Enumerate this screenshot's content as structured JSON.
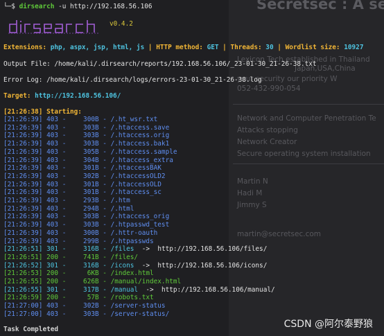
{
  "background_page": {
    "title": "Secretsec : A sec",
    "lines": [
      "Lexicon Tech established in Thailand",
      "Japan,USA,China",
      "your security our priority   W",
      "052-432-990-054",
      "Network and Computer Penetration Te",
      "Attacks stopping",
      "Network Creator",
      "Secure operating system installation",
      "Martin N",
      "Hadi M",
      "Jimmy S",
      "martin@secretsec.com"
    ]
  },
  "prompt": {
    "arrow": "└─$",
    "command": "dirsearch",
    "args": "-u http://192.168.56.106"
  },
  "logo": {
    "text": "dirsearch",
    "version": "v0.4.2"
  },
  "config": {
    "extensions_label": "Extensions:",
    "extensions_value": "php, aspx, jsp, html, js",
    "method_label": "HTTP method:",
    "method_value": "GET",
    "threads_label": "Threads:",
    "threads_value": "30",
    "wordlist_label": "Wordlist size:",
    "wordlist_value": "10927"
  },
  "output_file": {
    "label": "Output File:",
    "path": "/home/kali/.dirsearch/reports/192.168.56.106/_23-01-30_21-26-38.txt"
  },
  "error_log": {
    "label": "Error Log:",
    "path": "/home/kali/.dirsearch/logs/errors-23-01-30_21-26-38.log"
  },
  "target": {
    "label": "Target:",
    "url": "http://192.168.56.106/"
  },
  "starting": {
    "time": "[21:26:38]",
    "label": "Starting:"
  },
  "results": [
    {
      "time": "[21:26:39]",
      "code": "403",
      "size": "300B",
      "path": "/.ht_wsr.txt",
      "redirect": ""
    },
    {
      "time": "[21:26:39]",
      "code": "403",
      "size": "303B",
      "path": "/.htaccess.save",
      "redirect": ""
    },
    {
      "time": "[21:26:39]",
      "code": "403",
      "size": "303B",
      "path": "/.htaccess.orig",
      "redirect": ""
    },
    {
      "time": "[21:26:39]",
      "code": "403",
      "size": "303B",
      "path": "/.htaccess.bak1",
      "redirect": ""
    },
    {
      "time": "[21:26:39]",
      "code": "403",
      "size": "305B",
      "path": "/.htaccess.sample",
      "redirect": ""
    },
    {
      "time": "[21:26:39]",
      "code": "403",
      "size": "304B",
      "path": "/.htaccess_extra",
      "redirect": ""
    },
    {
      "time": "[21:26:39]",
      "code": "403",
      "size": "301B",
      "path": "/.htaccessBAK",
      "redirect": ""
    },
    {
      "time": "[21:26:39]",
      "code": "403",
      "size": "302B",
      "path": "/.htaccessOLD2",
      "redirect": ""
    },
    {
      "time": "[21:26:39]",
      "code": "403",
      "size": "301B",
      "path": "/.htaccessOLD",
      "redirect": ""
    },
    {
      "time": "[21:26:39]",
      "code": "403",
      "size": "301B",
      "path": "/.htaccess_sc",
      "redirect": ""
    },
    {
      "time": "[21:26:39]",
      "code": "403",
      "size": "293B",
      "path": "/.htm",
      "redirect": ""
    },
    {
      "time": "[21:26:39]",
      "code": "403",
      "size": "294B",
      "path": "/.html",
      "redirect": ""
    },
    {
      "time": "[21:26:39]",
      "code": "403",
      "size": "303B",
      "path": "/.htaccess_orig",
      "redirect": ""
    },
    {
      "time": "[21:26:39]",
      "code": "403",
      "size": "303B",
      "path": "/.htpasswd_test",
      "redirect": ""
    },
    {
      "time": "[21:26:39]",
      "code": "403",
      "size": "300B",
      "path": "/.httr-oauth",
      "redirect": ""
    },
    {
      "time": "[21:26:39]",
      "code": "403",
      "size": "299B",
      "path": "/.htpasswds",
      "redirect": ""
    },
    {
      "time": "[21:26:51]",
      "code": "301",
      "size": "316B",
      "path": "/files",
      "redirect": "http://192.168.56.106/files/"
    },
    {
      "time": "[21:26:51]",
      "code": "200",
      "size": "741B",
      "path": "/files/",
      "redirect": ""
    },
    {
      "time": "[21:26:52]",
      "code": "301",
      "size": "316B",
      "path": "/icons",
      "redirect": "http://192.168.56.106/icons/"
    },
    {
      "time": "[21:26:53]",
      "code": "200",
      "size": "6KB",
      "path": "/index.html",
      "redirect": ""
    },
    {
      "time": "[21:26:55]",
      "code": "200",
      "size": "626B",
      "path": "/manual/index.html",
      "redirect": ""
    },
    {
      "time": "[21:26:55]",
      "code": "301",
      "size": "317B",
      "path": "/manual",
      "redirect": "http://192.168.56.106/manual/"
    },
    {
      "time": "[21:26:59]",
      "code": "200",
      "size": "57B",
      "path": "/robots.txt",
      "redirect": ""
    },
    {
      "time": "[21:27:00]",
      "code": "403",
      "size": "302B",
      "path": "/server-status",
      "redirect": ""
    },
    {
      "time": "[21:27:00]",
      "code": "403",
      "size": "303B",
      "path": "/server-status/",
      "redirect": ""
    }
  ],
  "completed": "Task Completed",
  "watermark": "CSDN @阿尔泰野狼",
  "colors": {
    "prompt_green": "#5fc93a",
    "config_yellow": "#f2b636",
    "value_cyan": "#4ec3e0",
    "result_blue": "#5f8ef0",
    "success_green": "#5fc93a"
  }
}
